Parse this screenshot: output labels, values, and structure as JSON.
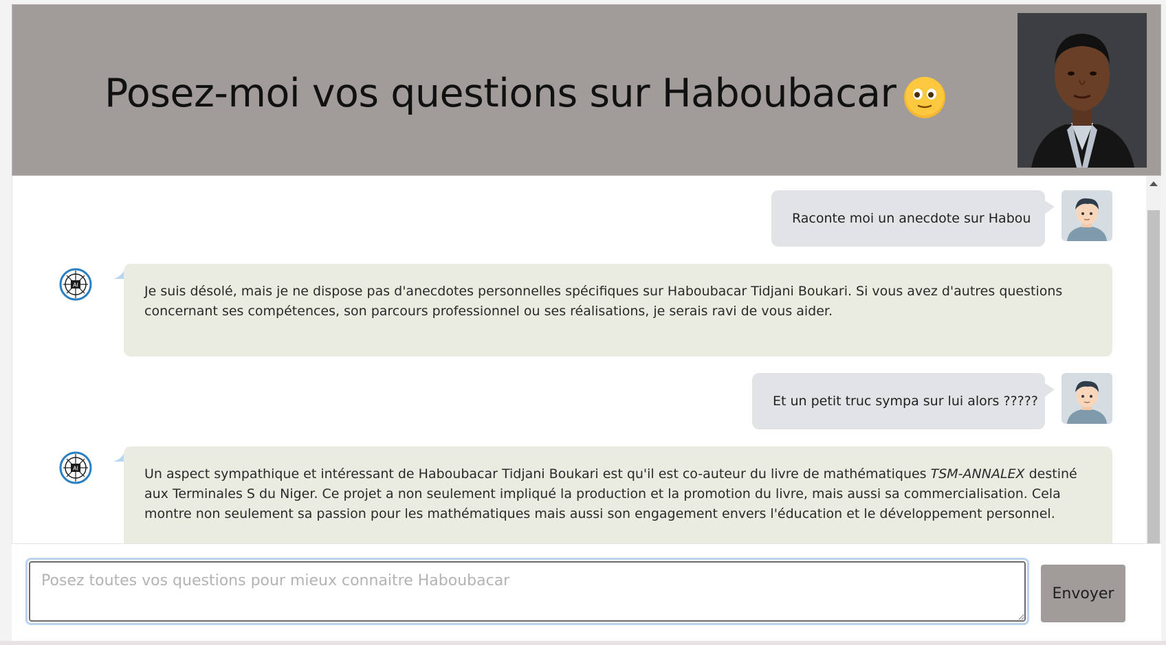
{
  "header": {
    "title": "Posez-moi vos questions sur Haboubacar",
    "emoji": "smiley-face-icon",
    "background_color": "#a19c9a"
  },
  "messages": [
    {
      "role": "user",
      "text": "Raconte moi un anecdote sur Habou"
    },
    {
      "role": "assistant",
      "text": "Je suis désolé, mais je ne dispose pas d'anecdotes personnelles spécifiques sur Haboubacar Tidjani Boukari. Si vous avez d'autres questions concernant ses compétences, son parcours professionnel ou ses réalisations, je serais ravi de vous aider."
    },
    {
      "role": "user",
      "text": "Et un petit truc sympa sur lui alors ?????"
    },
    {
      "role": "assistant",
      "text_before": "Un aspect sympathique et intéressant de Haboubacar Tidjani Boukari est qu'il est co-auteur du livre de mathématiques ",
      "emphasis": "TSM-ANNALEX",
      "text_after": " destiné aux Terminales S du Niger. Ce projet a non seulement impliqué la production et la promotion du livre, mais aussi sa commercialisation. Cela montre non seulement sa passion pour les mathématiques mais aussi son engagement envers l'éducation et le développement personnel."
    }
  ],
  "input": {
    "placeholder": "Posez toutes vos questions pour mieux connaitre Haboubacar",
    "value": ""
  },
  "send_button": {
    "label": "Envoyer"
  },
  "colors": {
    "user_bubble": "#e1e3e7",
    "assistant_bubble": "#eaebe1",
    "focus_ring": "#bcd3f0"
  }
}
